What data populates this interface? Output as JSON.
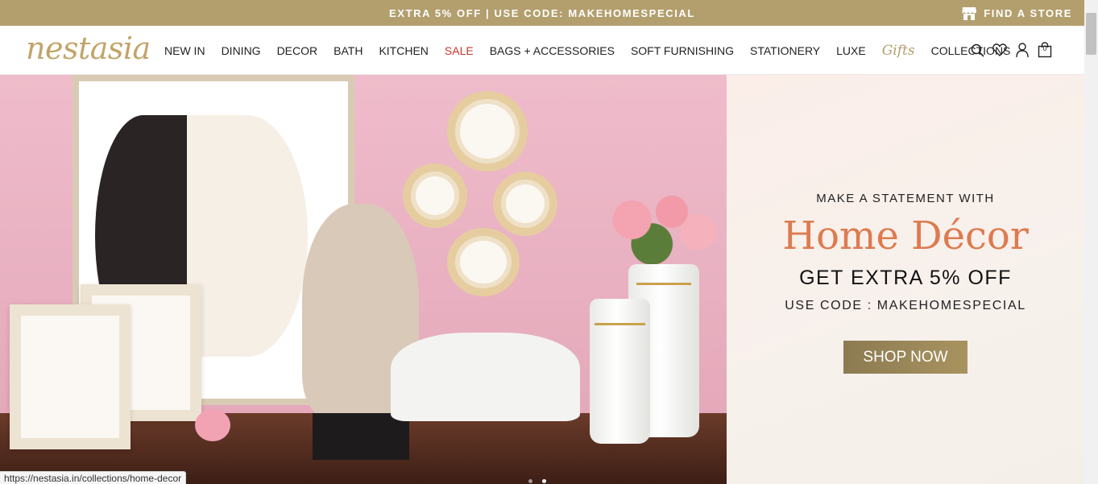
{
  "topbar": {
    "promo_text": "EXTRA 5% OFF | USE CODE: MAKEHOMESPECIAL",
    "store_label": "FIND A STORE",
    "bg_color": "#b39f6e"
  },
  "header": {
    "logo_text": "nestasia",
    "nav": [
      {
        "label": "NEW IN"
      },
      {
        "label": "DINING"
      },
      {
        "label": "DECOR"
      },
      {
        "label": "BATH"
      },
      {
        "label": "KITCHEN"
      },
      {
        "label": "SALE"
      },
      {
        "label": "BAGS + ACCESSORIES"
      },
      {
        "label": "SOFT FURNISHING"
      },
      {
        "label": "STATIONERY"
      },
      {
        "label": "LUXE"
      },
      {
        "label": "Gifts"
      },
      {
        "label": "COLLECTIONS"
      }
    ],
    "icons": [
      "search-icon",
      "wishlist-heart-icon",
      "account-icon",
      "cart-bag-icon"
    ],
    "cart_count": "0",
    "sale_color": "#c0392b"
  },
  "hero": {
    "subheading": "MAKE A STATEMENT WITH",
    "title": "Home Décor",
    "offer": "GET EXTRA 5% OFF",
    "code": "USE CODE : MAKEHOMESPECIAL",
    "cta": "SHOP NOW",
    "title_color": "#dd7b4f",
    "slides_count": 2,
    "active_slide": 2
  },
  "status_bar": {
    "url": "https://nestasia.in/collections/home-decor"
  }
}
